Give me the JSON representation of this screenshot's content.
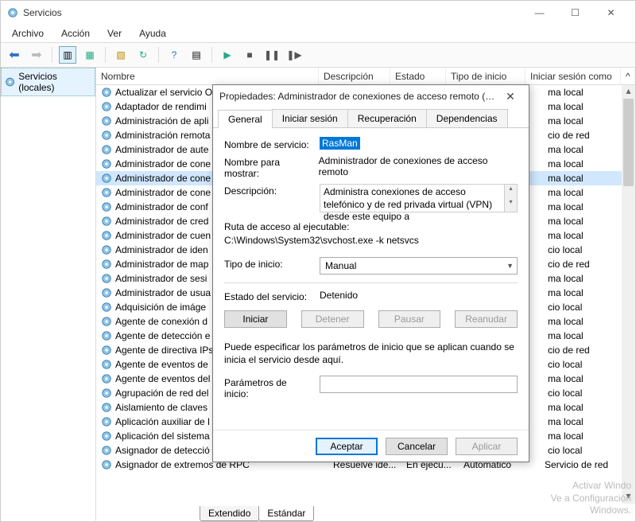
{
  "window": {
    "title": "Servicios"
  },
  "menu": {
    "file": "Archivo",
    "action": "Acción",
    "view": "Ver",
    "help": "Ayuda"
  },
  "tree": {
    "root": "Servicios (locales)"
  },
  "columns": {
    "name": "Nombre",
    "desc": "Descripción",
    "status": "Estado",
    "type": "Tipo de inicio",
    "logon": "Iniciar sesión como"
  },
  "tabs_bottom": {
    "ext": "Extendido",
    "std": "Estándar"
  },
  "watermark": {
    "line1": "Activar Windo",
    "line2": "Ve a Configuración",
    "line3": "Windows."
  },
  "services": [
    {
      "name": "Actualizar el servicio O",
      "logon": "ma local"
    },
    {
      "name": "Adaptador de rendimi",
      "logon": "ma local"
    },
    {
      "name": "Administración de apli",
      "logon": "ma local"
    },
    {
      "name": "Administración remota",
      "logon": "cio de red"
    },
    {
      "name": "Administrador de aute",
      "logon": "ma local"
    },
    {
      "name": "Administrador de cone",
      "logon": "ma local"
    },
    {
      "name": "Administrador de cone",
      "logon": "ma local",
      "selected": true
    },
    {
      "name": "Administrador de cone",
      "logon": "ma local"
    },
    {
      "name": "Administrador de conf",
      "logon": "ma local"
    },
    {
      "name": "Administrador de cred",
      "logon": "ma local"
    },
    {
      "name": "Administrador de cuen",
      "logon": "ma local"
    },
    {
      "name": "Administrador de iden",
      "logon": "cio local"
    },
    {
      "name": "Administrador de map",
      "logon": "cio de red"
    },
    {
      "name": "Administrador de sesi",
      "logon": "ma local"
    },
    {
      "name": "Administrador de usua",
      "logon": "ma local"
    },
    {
      "name": "Adquisición de imáge",
      "logon": "cio local"
    },
    {
      "name": "Agente de conexión d",
      "logon": "ma local"
    },
    {
      "name": "Agente de detección e",
      "logon": "ma local"
    },
    {
      "name": "Agente de directiva IPs",
      "logon": "cio de red"
    },
    {
      "name": "Agente de eventos de",
      "logon": "cio local"
    },
    {
      "name": "Agente de eventos del",
      "logon": "ma local"
    },
    {
      "name": "Agrupación de red del",
      "logon": "cio local"
    },
    {
      "name": "Aislamiento de claves",
      "logon": "ma local"
    },
    {
      "name": "Aplicación auxiliar de l",
      "logon": "ma local"
    },
    {
      "name": "Aplicación del sistema",
      "logon": "ma local"
    },
    {
      "name": "Asignador de detecció",
      "logon": "cio local"
    }
  ],
  "last_row": {
    "name": "Asignador de extremos de RPC",
    "desc": "Resuelve ide...",
    "status": "En ejecu...",
    "type": "Automático",
    "logon": "Servicio de red"
  },
  "dialog": {
    "title": "Propiedades: Administrador de conexiones de acceso remoto (Equi...",
    "tabs": {
      "general": "General",
      "logon": "Iniciar sesión",
      "recovery": "Recuperación",
      "deps": "Dependencias"
    },
    "service_name_lbl": "Nombre de servicio:",
    "service_name_val": "RasMan",
    "display_name_lbl": "Nombre para mostrar:",
    "display_name_val": "Administrador de conexiones de acceso remoto",
    "desc_lbl": "Descripción:",
    "desc_val": "Administra conexiones de acceso telefónico y de red privada virtual (VPN) desde este equipo a",
    "path_lbl": "Ruta de acceso al ejecutable:",
    "path_val": "C:\\Windows\\System32\\svchost.exe -k netsvcs",
    "startup_lbl": "Tipo de inicio:",
    "startup_val": "Manual",
    "state_lbl": "Estado del servicio:",
    "state_val": "Detenido",
    "btn_start": "Iniciar",
    "btn_stop": "Detener",
    "btn_pause": "Pausar",
    "btn_resume": "Reanudar",
    "note": "Puede especificar los parámetros de inicio que se aplican cuando se inicia el servicio desde aquí.",
    "params_lbl": "Parámetros de inicio:",
    "ok": "Aceptar",
    "cancel": "Cancelar",
    "apply": "Aplicar"
  }
}
